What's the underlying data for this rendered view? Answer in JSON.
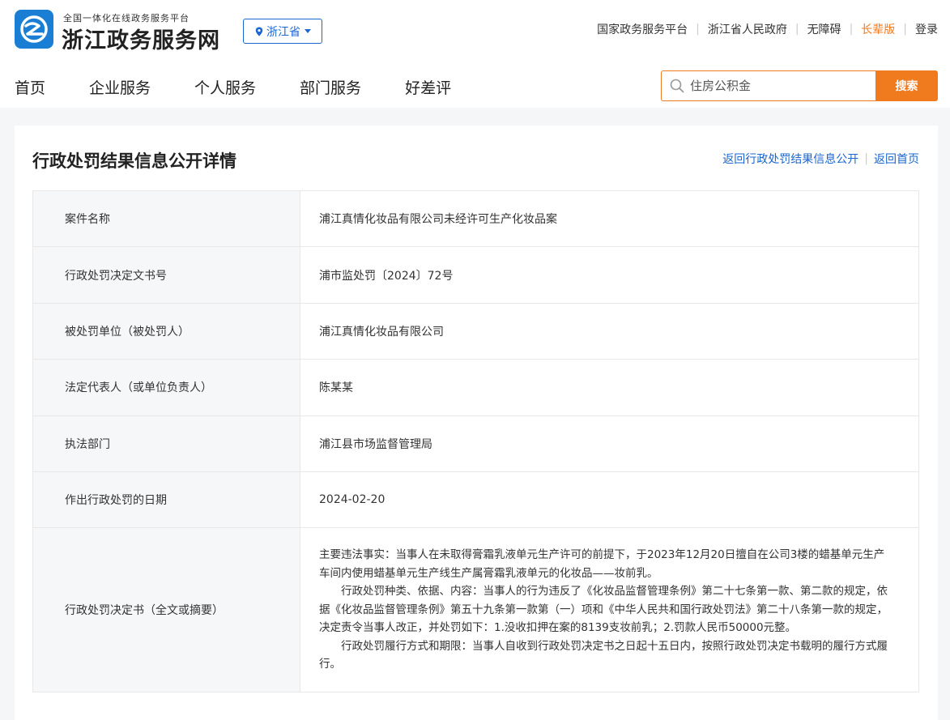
{
  "brand": {
    "subtitle": "全国一体化在线政务服务平台",
    "name": "浙江政务服务网",
    "logo_icon": "zhejiang-government-logo",
    "logo_color": "#1a7fd4"
  },
  "region_selector": {
    "label": "浙江省",
    "icon": "location-pin-icon"
  },
  "top_links": {
    "national_platform": "国家政务服务平台",
    "provincial_gov": "浙江省人民政府",
    "accessibility": "无障碍",
    "elder_mode": "长辈版",
    "login": "登录"
  },
  "nav": {
    "home": "首页",
    "enterprise": "企业服务",
    "personal": "个人服务",
    "department": "部门服务",
    "rating": "好差评"
  },
  "search": {
    "placeholder": "住房公积金",
    "button": "搜索"
  },
  "page": {
    "title": "行政处罚结果信息公开详情",
    "back_link": "返回行政处罚结果信息公开",
    "home_link": "返回首页"
  },
  "details": {
    "case_name": {
      "label": "案件名称",
      "value": "浦江真情化妆品有限公司未经许可生产化妆品案"
    },
    "decision_no": {
      "label": "行政处罚决定文书号",
      "value": "浦市监处罚〔2024〕72号"
    },
    "party": {
      "label": "被处罚单位（被处罚人）",
      "value": "浦江真情化妆品有限公司"
    },
    "legal_rep": {
      "label": "法定代表人（或单位负责人）",
      "value": "陈某某"
    },
    "enforcement_dept": {
      "label": "执法部门",
      "value": "浦江县市场监督管理局"
    },
    "decision_date": {
      "label": "作出行政处罚的日期",
      "value": "2024-02-20"
    },
    "decision_text": {
      "label": "行政处罚决定书（全文或摘要）",
      "facts": "主要违法事实：当事人在未取得膏霜乳液单元生产许可的前提下，于2023年12月20日擅自在公司3楼的蜡基单元生产车间内使用蜡基单元生产线生产属膏霜乳液单元的化妆品——妆前乳。",
      "penalty": "行政处罚种类、依据、内容：当事人的行为违反了《化妆品监督管理条例》第二十七条第一款、第二款的规定，依据《化妆品监督管理条例》第五十九条第一款第（一）项和《中华人民共和国行政处罚法》第二十八条第一款的规定，决定责令当事人改正，并处罚如下：1.没收扣押在案的8139支妆前乳；2.罚款人民币50000元整。",
      "performance": "行政处罚履行方式和期限：当事人自收到行政处罚决定书之日起十五日内，按照行政处罚决定书载明的履行方式履行。"
    }
  },
  "colors": {
    "primary_blue": "#1a66d2",
    "accent_orange": "#f07a1e"
  }
}
